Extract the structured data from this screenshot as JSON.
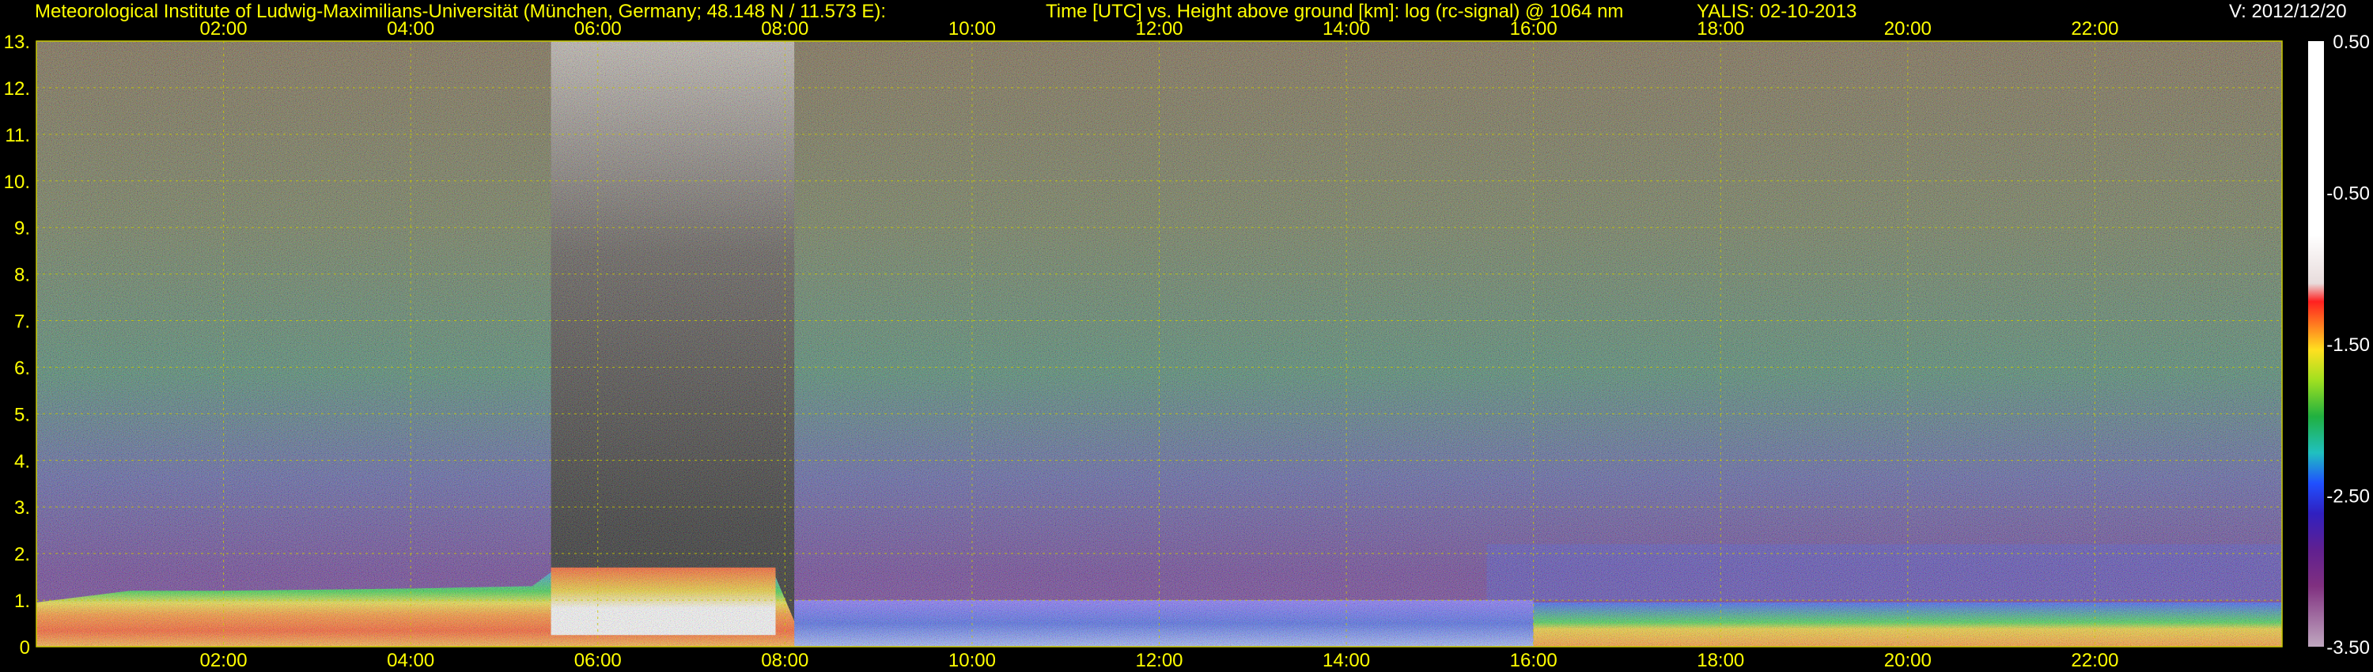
{
  "header": {
    "institute": "Meteorological Institute of Ludwig-Maximilians-Universität (München, Germany; 48.148 N / 11.573 E):",
    "plot_desc": "Time [UTC] vs. Height above ground [km]: log (rc-signal) @ 1064 nm",
    "instrument": "YALIS: 02-10-2013",
    "version": "V: 2012/12/20"
  },
  "colors": {
    "header_text": "#ffff00",
    "version_text": "#ffffff",
    "axis_text": "#ffff00",
    "colorbar_text": "#ffffff",
    "background": "#000000",
    "grid": "#c8c800"
  },
  "chart_data": {
    "type": "heatmap",
    "title": "Time [UTC] vs. Height above ground [km]: log (rc-signal) @ 1064 nm",
    "xlabel": "Time [UTC]",
    "ylabel": "Height above ground [km]",
    "xlim_hours": [
      0,
      24
    ],
    "ylim": [
      0,
      13
    ],
    "x_ticks": [
      "02:00",
      "04:00",
      "06:00",
      "08:00",
      "10:00",
      "12:00",
      "14:00",
      "16:00",
      "18:00",
      "20:00",
      "22:00"
    ],
    "x_tick_hours": [
      2,
      4,
      6,
      8,
      10,
      12,
      14,
      16,
      18,
      20,
      22
    ],
    "y_ticks": [
      "0",
      "1.",
      "2.",
      "3.",
      "4.",
      "5.",
      "6.",
      "7.",
      "8.",
      "9.",
      "10.",
      "11.",
      "12.",
      "13."
    ],
    "y_tick_values": [
      0,
      1,
      2,
      3,
      4,
      5,
      6,
      7,
      8,
      9,
      10,
      11,
      12,
      13
    ],
    "grid": true,
    "colorbar": {
      "ticks": [
        "0.50",
        "-0.50",
        "-1.50",
        "-2.50",
        "-3.50"
      ],
      "tick_values": [
        0.5,
        -0.5,
        -1.5,
        -2.5,
        -3.5
      ],
      "range": [
        -3.5,
        0.5
      ]
    },
    "boundary_layer_top_km": [
      [
        0.0,
        0.95
      ],
      [
        1.0,
        1.2
      ],
      [
        2.0,
        1.2
      ],
      [
        4.0,
        1.25
      ],
      [
        5.3,
        1.3
      ],
      [
        5.5,
        1.6
      ],
      [
        7.0,
        1.7
      ],
      [
        7.9,
        1.5
      ],
      [
        8.1,
        0.55
      ],
      [
        9.0,
        0.9
      ],
      [
        12.0,
        1.0
      ],
      [
        15.0,
        1.0
      ],
      [
        17.0,
        0.9
      ],
      [
        20.0,
        0.85
      ],
      [
        24.0,
        0.6
      ]
    ]
  }
}
